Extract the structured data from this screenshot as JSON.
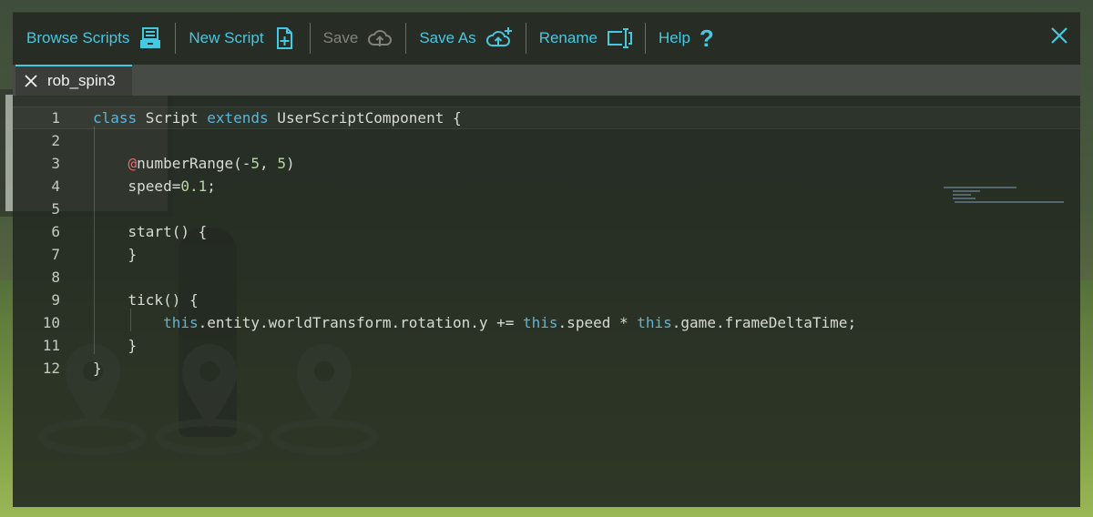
{
  "toolbar": {
    "browse_label": "Browse Scripts",
    "new_label": "New Script",
    "save_label": "Save",
    "save_as_label": "Save As",
    "rename_label": "Rename",
    "help_label": "Help",
    "help_glyph": "?"
  },
  "tabs": [
    {
      "label": "rob_spin3"
    }
  ],
  "colors": {
    "accent": "#46c8e0",
    "keyword": "#5fb3d6",
    "number": "#b8d7a3",
    "decorator": "#e06c75"
  },
  "code": {
    "line_numbers": [
      "1",
      "2",
      "3",
      "4",
      "5",
      "6",
      "7",
      "8",
      "9",
      "10",
      "11",
      "12"
    ],
    "lines": [
      [
        {
          "t": "class",
          "c": "kw"
        },
        {
          "t": " Script ",
          "c": ""
        },
        {
          "t": "extends",
          "c": "kw"
        },
        {
          "t": " UserScriptComponent {",
          "c": ""
        }
      ],
      [],
      [
        {
          "t": "    ",
          "c": ""
        },
        {
          "t": "@",
          "c": "dec"
        },
        {
          "t": "numberRange(-",
          "c": ""
        },
        {
          "t": "5",
          "c": "num"
        },
        {
          "t": ", ",
          "c": ""
        },
        {
          "t": "5",
          "c": "num"
        },
        {
          "t": ")",
          "c": ""
        }
      ],
      [
        {
          "t": "    speed=",
          "c": ""
        },
        {
          "t": "0.1",
          "c": "num"
        },
        {
          "t": ";",
          "c": ""
        }
      ],
      [],
      [
        {
          "t": "    start() {",
          "c": ""
        }
      ],
      [
        {
          "t": "    }",
          "c": ""
        }
      ],
      [],
      [
        {
          "t": "    tick() {",
          "c": ""
        }
      ],
      [
        {
          "t": "        ",
          "c": ""
        },
        {
          "t": "this",
          "c": "kw"
        },
        {
          "t": ".entity.worldTransform.rotation.y += ",
          "c": ""
        },
        {
          "t": "this",
          "c": "kw"
        },
        {
          "t": ".speed * ",
          "c": ""
        },
        {
          "t": "this",
          "c": "kw"
        },
        {
          "t": ".game.frameDeltaTime;",
          "c": ""
        }
      ],
      [
        {
          "t": "    }",
          "c": ""
        }
      ],
      [
        {
          "t": "}",
          "c": ""
        }
      ]
    ]
  }
}
